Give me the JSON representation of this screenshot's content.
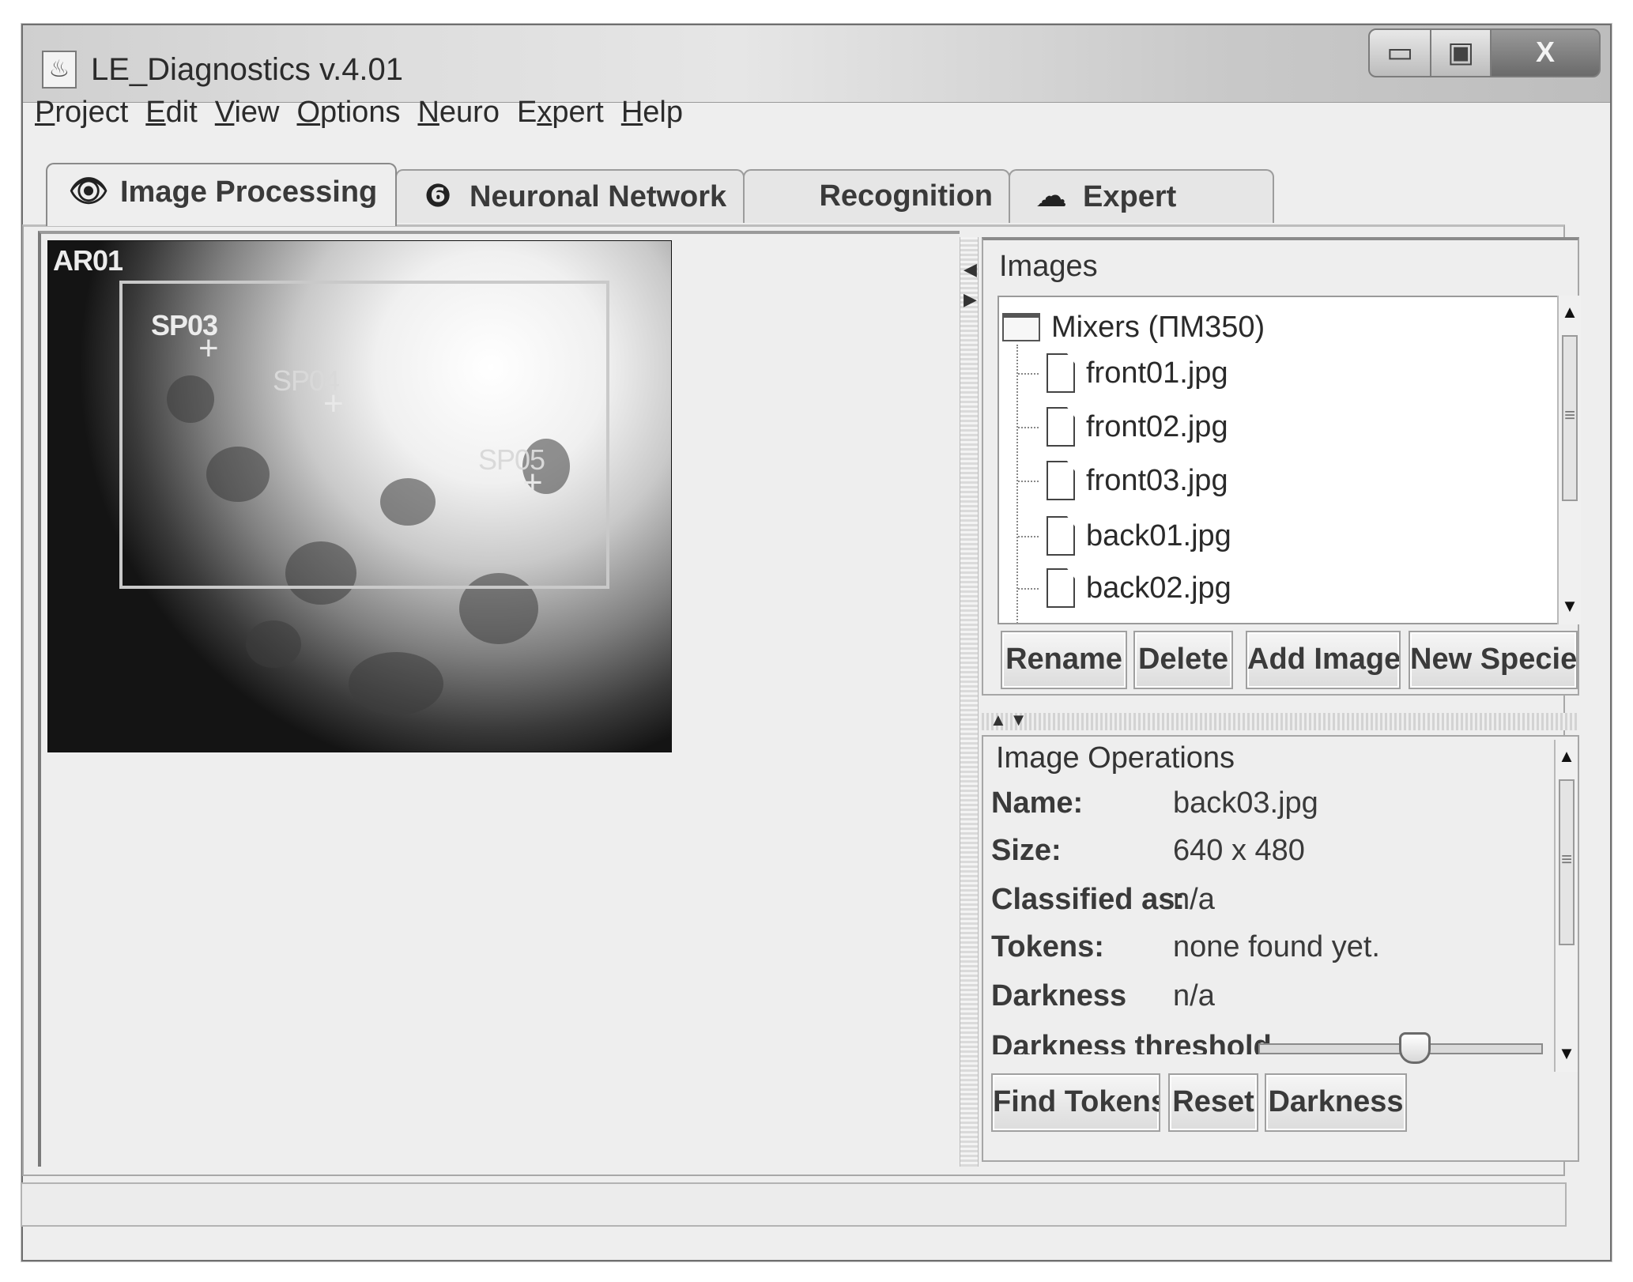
{
  "window": {
    "title": "LE_Diagnostics v.4.01",
    "controls": {
      "minimize": "▭",
      "maximize": "▣",
      "close": "X"
    }
  },
  "menu": [
    {
      "mnemonic": "P",
      "rest": "roject"
    },
    {
      "mnemonic": "E",
      "rest": "dit"
    },
    {
      "mnemonic": "V",
      "rest": "iew"
    },
    {
      "mnemonic": "O",
      "rest": "ptions"
    },
    {
      "mnemonic": "N",
      "rest": "euro"
    },
    {
      "lead": "E",
      "mnemonic": "x",
      "rest": "pert"
    },
    {
      "mnemonic": "H",
      "rest": "elp"
    }
  ],
  "tabs": [
    {
      "label": "Image Processing",
      "icon": "eye-icon",
      "glyph": "👁",
      "active": true
    },
    {
      "label": "Neuronal Network",
      "icon": "neuron-icon",
      "glyph": "❻",
      "active": false
    },
    {
      "label": "Recognition",
      "icon": "",
      "glyph": "",
      "active": false
    },
    {
      "label": "Expert",
      "icon": "brain-icon",
      "glyph": "☁",
      "active": false
    }
  ],
  "image_view": {
    "image_label": "AR01",
    "points": [
      "SP03",
      "SP04",
      "SP05"
    ]
  },
  "images_panel": {
    "title": "Images",
    "folder": "Mixers (ПМ350)",
    "files": [
      "front01.jpg",
      "front02.jpg",
      "front03.jpg",
      "back01.jpg",
      "back02.jpg"
    ],
    "buttons": {
      "rename": "Rename",
      "delete": "Delete",
      "add_image": "Add Image",
      "new_species": "New Species"
    }
  },
  "operations_panel": {
    "title": "Image Operations",
    "rows": [
      {
        "key": "Name:",
        "value": "back03.jpg"
      },
      {
        "key": "Size:",
        "value": "640 x 480"
      },
      {
        "key": "Classified as:",
        "value": "n/a"
      },
      {
        "key": "Tokens:",
        "value": "none found yet."
      },
      {
        "key": "Darkness",
        "value": "n/a"
      }
    ],
    "threshold_label": "Darkness threshold",
    "threshold_value": 0.55,
    "buttons": {
      "find_tokens": "Find Tokens",
      "reset": "Reset",
      "darkness": "Darkness"
    }
  },
  "colors": {
    "window_bg": "#eeeeee",
    "border": "#a0a0a0",
    "text": "#2a2a2a"
  }
}
